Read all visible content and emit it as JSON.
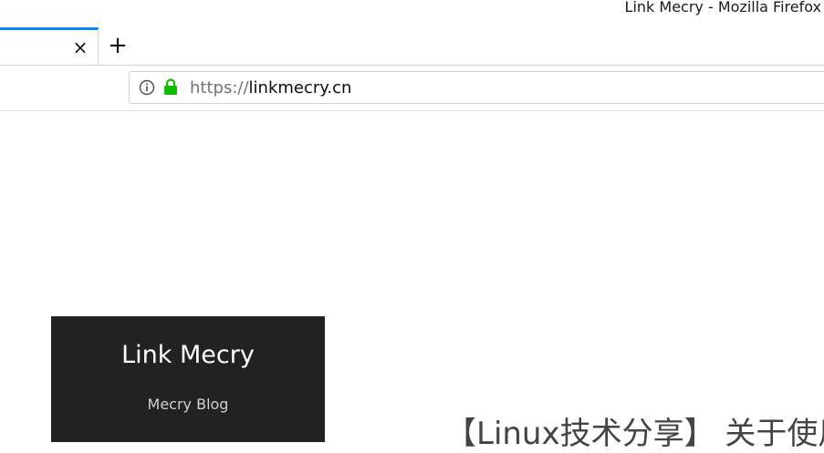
{
  "window": {
    "title": "Link Mecry - Mozilla Firefox"
  },
  "tabs": {
    "close_label": "×",
    "new_tab_label": "+"
  },
  "urlbar": {
    "scheme": "https://",
    "host": "linkmecry.cn"
  },
  "colors": {
    "tab_accent": "#0a84ff",
    "lock_green": "#12bc00",
    "header_bg": "#222222"
  },
  "icons": {
    "info": "info-icon",
    "lock": "lock-icon"
  },
  "page": {
    "site_title": "Link Mecry",
    "site_subtitle": "Mecry Blog",
    "post_title": "【Linux技术分享】 关于使用"
  }
}
